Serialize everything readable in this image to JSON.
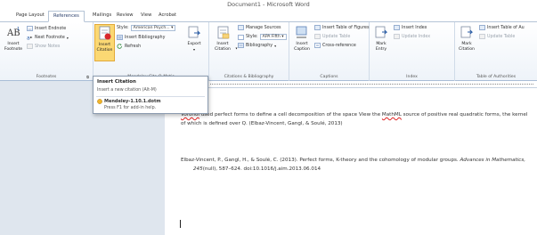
{
  "window": {
    "title": "Document1 - Microsoft Word"
  },
  "tabs": [
    {
      "label": "Page Layout"
    },
    {
      "label": "References",
      "active": true
    },
    {
      "label": "Mailings"
    },
    {
      "label": "Review"
    },
    {
      "label": "View"
    },
    {
      "label": "Acrobat"
    }
  ],
  "ribbon": {
    "footnotes": {
      "label": "Footnotes",
      "insert_footnote": "Insert Footnote",
      "insert_endnote": "Insert Endnote",
      "next_footnote": "Next Footnote",
      "show_notes": "Show Notes"
    },
    "mendeley": {
      "label": "Mendeley Cite-O-Matic",
      "insert_citation": "Insert Citation",
      "style_label": "Style:",
      "style_value": "American Psych...",
      "insert_bibliography": "Insert Bibliography",
      "refresh": "Refresh",
      "export": "Export"
    },
    "citations": {
      "label": "Citations & Bibliography",
      "insert_citation": "Insert Citation",
      "manage_sources": "Manage Sources",
      "style_label": "Style:",
      "style_value": "APA Fifth",
      "bibliography": "Bibliography"
    },
    "captions": {
      "label": "Captions",
      "insert_caption": "Insert Caption",
      "insert_table_of_figures": "Insert Table of Figures",
      "update_table": "Update Table",
      "cross_reference": "Cross-reference"
    },
    "index": {
      "label": "Index",
      "mark_entry": "Mark Entry",
      "insert_index": "Insert Index",
      "update_index": "Update Index"
    },
    "toa": {
      "label": "Table of Authorities",
      "mark_citation": "Mark Citation",
      "insert_table_of_authorities": "Insert Table of Au",
      "update_table": "Update Table"
    }
  },
  "tooltip": {
    "title": "Insert Citation",
    "description": "Insert a new citation (Alt-M)",
    "plugin": "Mendeley-1.10.1.dotm",
    "help": "Press F1 for add-in help."
  },
  "document": {
    "para1": {
      "word1": "Voronoi",
      "text1": " used perfect forms to define a cell decomposition of the space View the ",
      "word2": "MathML",
      "text2": " source of positive real quadratic forms, the kernel of which is defined over Q. (Elbaz-Vincent, Gangl, & Soulé, 2013)"
    },
    "ref": {
      "text": "Elbaz-Vincent, P., Gangl, H., & Soulé, C. (2013). Perfect forms, K-theory and the cohomology of modular groups. ",
      "journal": "Advances in Mathematics, 245",
      "tail": "(null), 587–624. doi:10.1016/j.aim.2013.06.014"
    }
  }
}
